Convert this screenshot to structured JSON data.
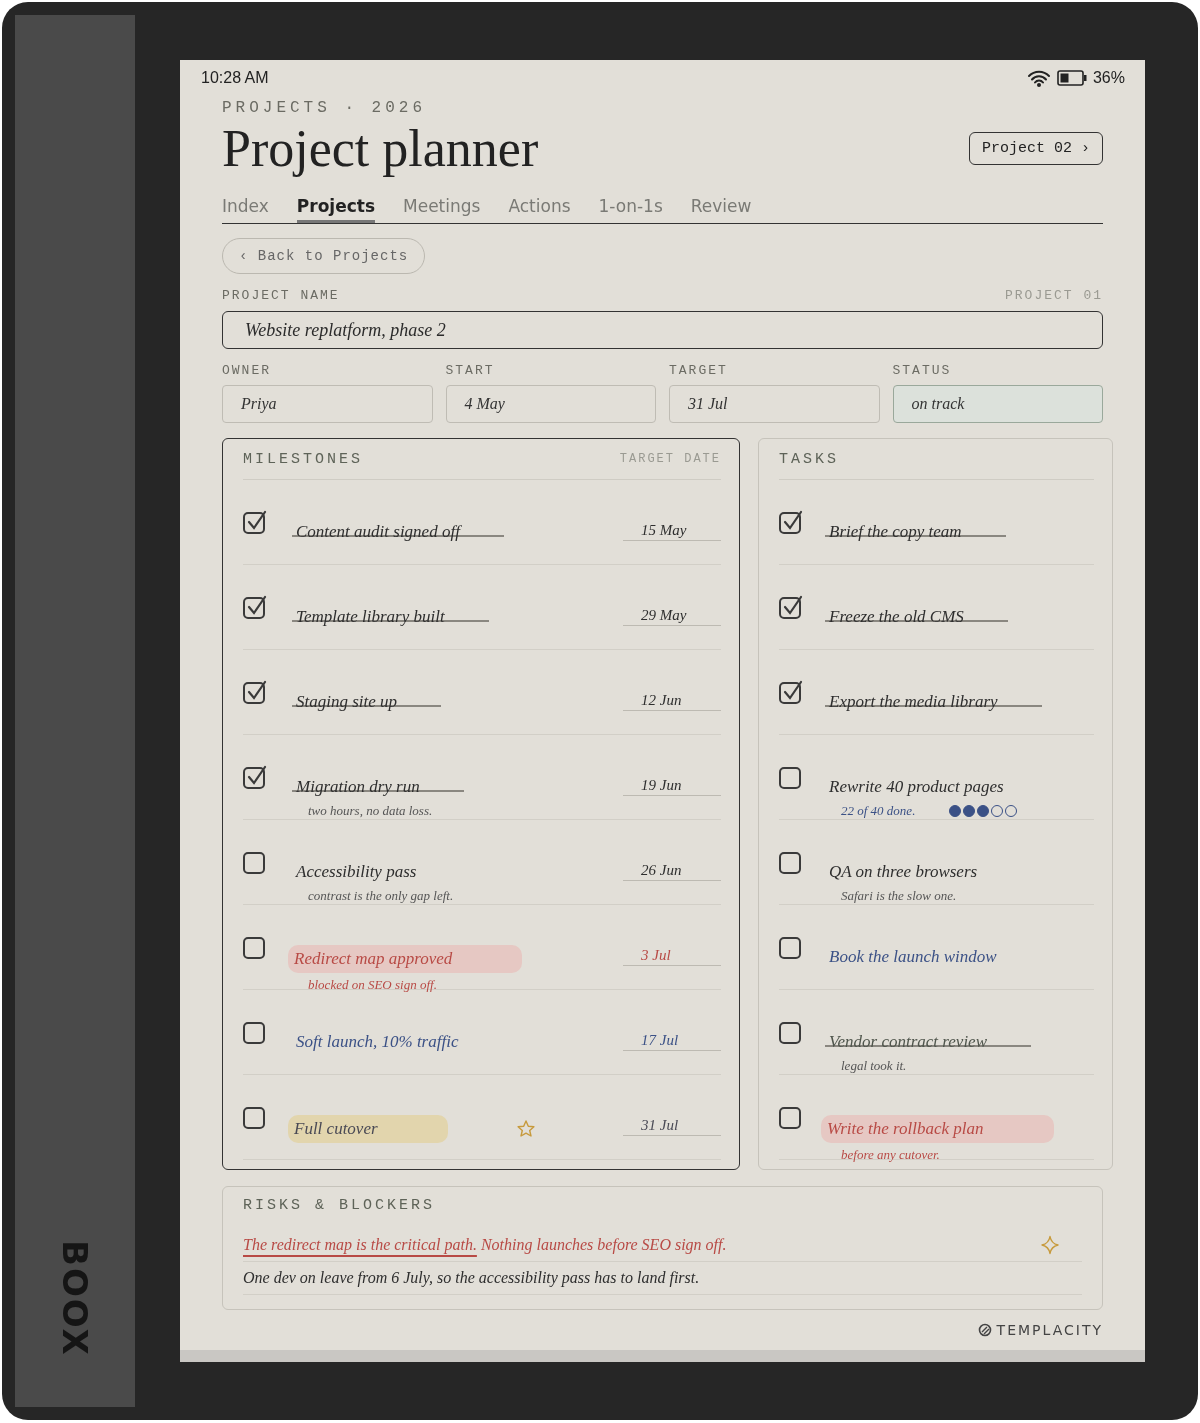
{
  "device": {
    "brand": "BOOX"
  },
  "status_bar": {
    "time": "10:28 AM",
    "battery": "36%"
  },
  "header": {
    "eyebrow": "PROJECTS · 2026",
    "title": "Project planner",
    "next_button": "Project 02 ›"
  },
  "tabs": [
    {
      "label": "Index",
      "selected": false
    },
    {
      "label": "Projects",
      "selected": true
    },
    {
      "label": "Meetings",
      "selected": false
    },
    {
      "label": "Actions",
      "selected": false
    },
    {
      "label": "1-on-1s",
      "selected": false
    },
    {
      "label": "Review",
      "selected": false
    }
  ],
  "back_button": "‹ Back to Projects",
  "project": {
    "name_label": "PROJECT NAME",
    "number": "PROJECT 01",
    "name": "Website replatform, phase 2"
  },
  "fields": [
    {
      "label": "OWNER",
      "value": "Priya",
      "kind": "plain"
    },
    {
      "label": "START",
      "value": "4 May",
      "kind": "plain"
    },
    {
      "label": "TARGET",
      "value": "31 Jul",
      "kind": "plain"
    },
    {
      "label": "STATUS",
      "value": "on track",
      "kind": "status"
    }
  ],
  "milestones": {
    "title": "MILESTONES",
    "column_label": "TARGET DATE",
    "focused": true,
    "items": [
      {
        "text": "Content audit signed off",
        "date": "15 May",
        "checked": true,
        "struck": true,
        "color": "#2e2e2e",
        "starred": false
      },
      {
        "text": "Template library built",
        "date": "29 May",
        "checked": true,
        "struck": true,
        "color": "#2e2e2e",
        "starred": false
      },
      {
        "text": "Staging site up",
        "date": "12 Jun",
        "checked": true,
        "struck": true,
        "color": "#2e2e2e",
        "starred": false
      },
      {
        "text": "Migration dry run",
        "note": {
          "text": "two hours, no data loss.",
          "color": "#555555"
        },
        "date": "19 Jun",
        "checked": true,
        "struck": true,
        "color": "#2e2e2e",
        "starred": false
      },
      {
        "text": "Accessibility pass",
        "note": {
          "text": "contrast is the only gap left.",
          "color": "#555555"
        },
        "date": "26 Jun",
        "checked": false,
        "struck": false,
        "color": "#2e2e2e",
        "starred": false
      },
      {
        "text": "Redirect map approved",
        "note": {
          "text": "blocked on SEO sign off.",
          "color": "#b84a45"
        },
        "date": "3 Jul",
        "checked": false,
        "struck": false,
        "color": "#b84a45",
        "highlight": {
          "color": "#e6c8c3"
        },
        "starred": false
      },
      {
        "text": "Soft launch, 10% traffic",
        "date": "17 Jul",
        "checked": false,
        "struck": false,
        "color": "#3b5186",
        "starred": false
      },
      {
        "text": "Full cutover",
        "date": "31 Jul",
        "checked": false,
        "struck": false,
        "color": "#4a4a55",
        "highlight": {
          "color": "#e2d5ad"
        },
        "starred": true
      }
    ]
  },
  "tasks": {
    "title": "TASKS",
    "focused": false,
    "items": [
      {
        "text": "Brief the copy team",
        "checked": true,
        "struck": true,
        "color": "#2e2e2e"
      },
      {
        "text": "Freeze the old CMS",
        "checked": true,
        "struck": true,
        "color": "#2e2e2e"
      },
      {
        "text": "Export the media library",
        "checked": true,
        "struck": true,
        "color": "#2e2e2e"
      },
      {
        "text": "Rewrite 40 product pages",
        "note": {
          "text": "22 of 40 done.",
          "color": "#3b5186"
        },
        "stars": 3,
        "checked": false,
        "struck": false,
        "color": "#2e2e2e"
      },
      {
        "text": "QA on three browsers",
        "note": {
          "text": "Safari is the slow one.",
          "color": "#555555"
        },
        "checked": false,
        "struck": false,
        "color": "#2e2e2e"
      },
      {
        "text": "Book the launch window",
        "checked": false,
        "struck": false,
        "color": "#3b5186"
      },
      {
        "text": "Vendor contract review",
        "note": {
          "text": "legal took it.",
          "color": "#555555"
        },
        "checked": false,
        "struck": true,
        "color": "#4f554c"
      },
      {
        "text": "Write the rollback plan",
        "note": {
          "text": "before any cutover.",
          "color": "#b84a45"
        },
        "checked": false,
        "struck": false,
        "color": "#b84a45",
        "highlight": {
          "color": "#e6c8c3"
        }
      }
    ]
  },
  "risks": {
    "title": "RISKS & BLOCKERS",
    "lines": [
      {
        "underlined": "The redirect map is the critical path.",
        "text": "Nothing launches before SEO sign off.",
        "color": "#b84a45",
        "starred": true
      },
      {
        "text": "One dev on leave from 6 July, so the accessibility pass has to land first.",
        "color": "#2e2e2e",
        "starred": false
      }
    ]
  },
  "footer": {
    "logo": "TEMPLACITY"
  }
}
